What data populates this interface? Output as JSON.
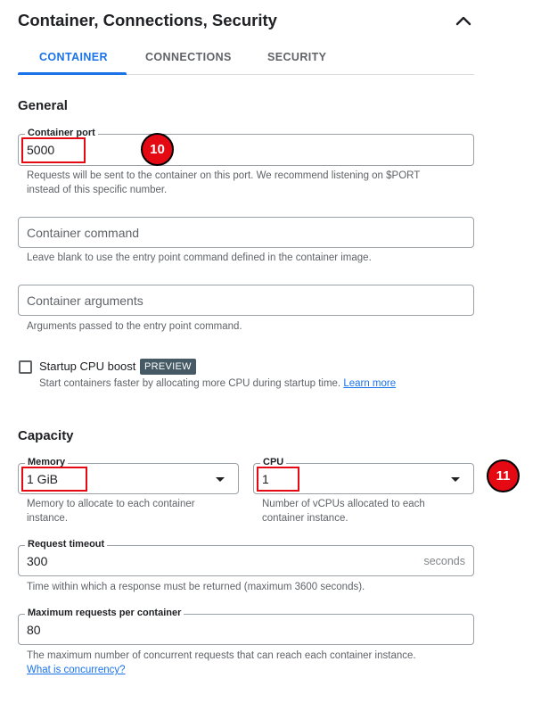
{
  "header": {
    "title": "Container, Connections, Security"
  },
  "tabs": [
    {
      "label": "CONTAINER",
      "active": true
    },
    {
      "label": "CONNECTIONS",
      "active": false
    },
    {
      "label": "SECURITY",
      "active": false
    }
  ],
  "general": {
    "heading": "General",
    "container_port": {
      "label": "Container port",
      "value": "5000",
      "hint": "Requests will be sent to the container on this port. We recommend listening on $PORT",
      "hint_line2": "instead of this specific number."
    },
    "container_command": {
      "placeholder": "Container command",
      "hint": "Leave blank to use the entry point command defined in the container image."
    },
    "container_arguments": {
      "placeholder": "Container arguments",
      "hint": "Arguments passed to the entry point command."
    },
    "startup_boost": {
      "label": "Startup CPU boost",
      "badge": "PREVIEW",
      "checked": false,
      "hint": "Start containers faster by allocating more CPU during startup time.",
      "link": "Learn more"
    }
  },
  "capacity": {
    "heading": "Capacity",
    "memory": {
      "label": "Memory",
      "value": "1 GiB",
      "hint": "Memory to allocate to each container",
      "hint_line2": "instance."
    },
    "cpu": {
      "label": "CPU",
      "value": "1",
      "hint": "Number of vCPUs allocated to each",
      "hint_line2": "container instance."
    },
    "request_timeout": {
      "label": "Request timeout",
      "value": "300",
      "suffix": "seconds",
      "hint": "Time within which a response must be returned (maximum 3600 seconds)."
    },
    "max_requests": {
      "label": "Maximum requests per container",
      "value": "80",
      "hint": "The maximum number of concurrent requests that can reach each container instance.",
      "link": "What is concurrency?"
    }
  },
  "annotations": {
    "step_10": "10",
    "step_11": "11"
  },
  "colors": {
    "accent": "#1a73e8",
    "annotation_red": "#e50914",
    "badge_bg": "#455a64"
  },
  "icons": {
    "collapse": "chevron-up-icon",
    "dropdown": "dropdown-arrow-icon"
  }
}
